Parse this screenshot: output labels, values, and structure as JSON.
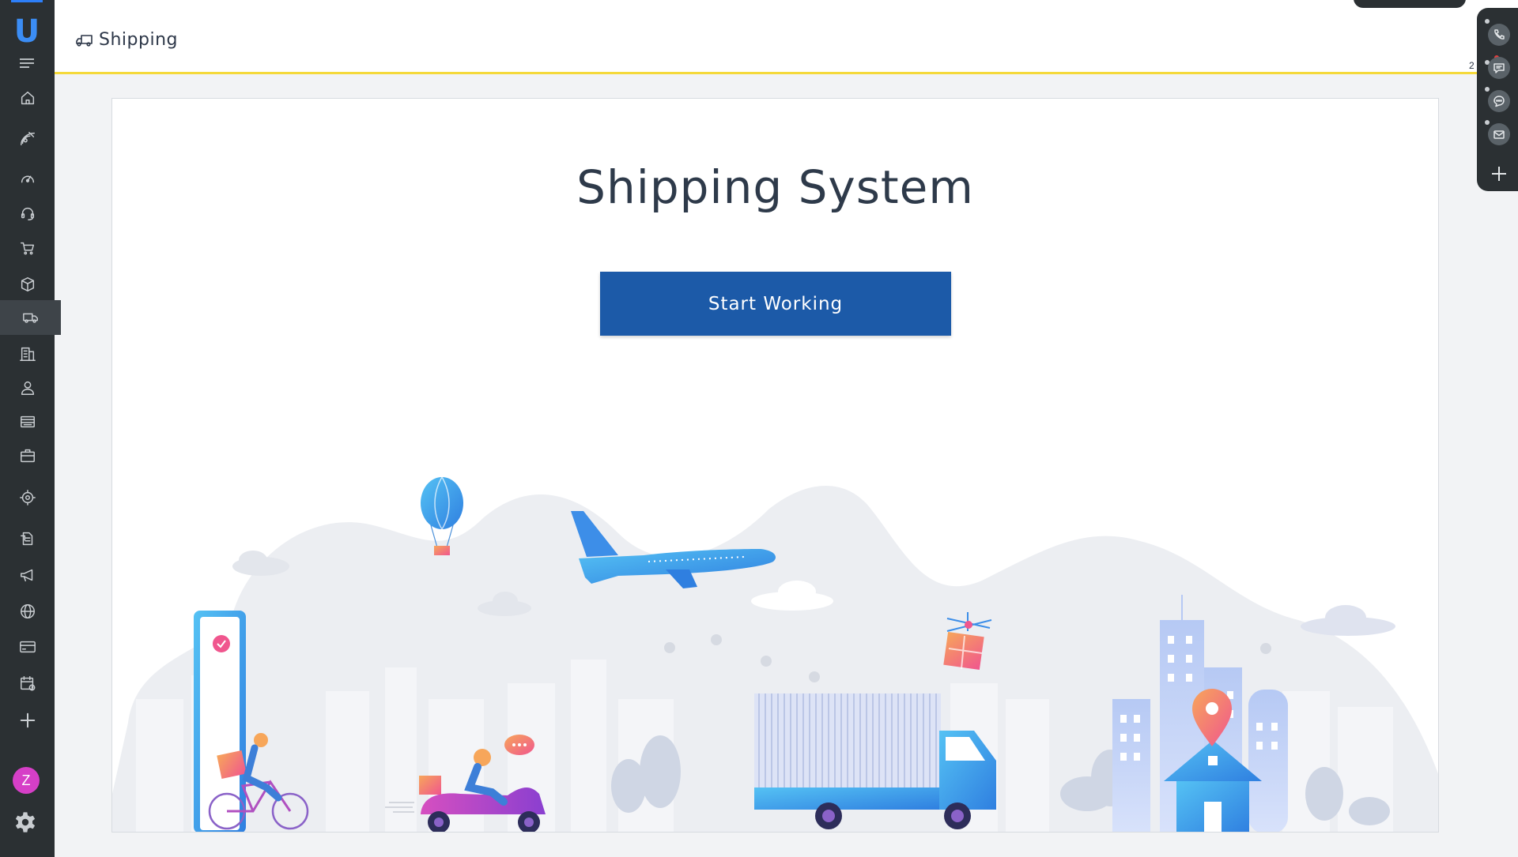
{
  "header": {
    "icon": "truck-icon",
    "title": "Shipping"
  },
  "main": {
    "heading": "Shipping System",
    "cta_label": "Start Working"
  },
  "sidebar": {
    "logo": "U",
    "items": [
      {
        "name": "home",
        "icon": "home-icon"
      },
      {
        "name": "satellite",
        "icon": "satellite-icon"
      },
      {
        "name": "dashboard",
        "icon": "gauge-icon"
      },
      {
        "name": "support",
        "icon": "headset-icon"
      },
      {
        "name": "cart",
        "icon": "cart-icon"
      },
      {
        "name": "products",
        "icon": "box-icon"
      },
      {
        "name": "shipping",
        "icon": "truck-icon",
        "active": true
      },
      {
        "name": "buildings",
        "icon": "building-icon"
      },
      {
        "name": "contacts",
        "icon": "user-icon"
      },
      {
        "name": "list",
        "icon": "list-icon"
      },
      {
        "name": "projects",
        "icon": "briefcase-icon"
      },
      {
        "name": "sun",
        "icon": "sun-target-icon"
      },
      {
        "name": "tasks",
        "icon": "clipboard-icon"
      },
      {
        "name": "campaigns",
        "icon": "megaphone-icon"
      },
      {
        "name": "web",
        "icon": "globe-icon"
      },
      {
        "name": "billing",
        "icon": "credit-card-icon"
      },
      {
        "name": "calendar",
        "icon": "calendar-icon"
      },
      {
        "name": "add",
        "icon": "plus-icon"
      }
    ],
    "avatar_initial": "Z"
  },
  "right_toolbar": {
    "items": [
      "phone-icon",
      "chat-icon",
      "message-icon",
      "mail-icon",
      "plus-icon"
    ],
    "badge_count": "2"
  },
  "colors": {
    "sidebar_bg": "#2b3033",
    "accent_line": "#f5d93a",
    "button_bg": "#1c5aa8",
    "avatar_bg": "#d63fc7"
  }
}
